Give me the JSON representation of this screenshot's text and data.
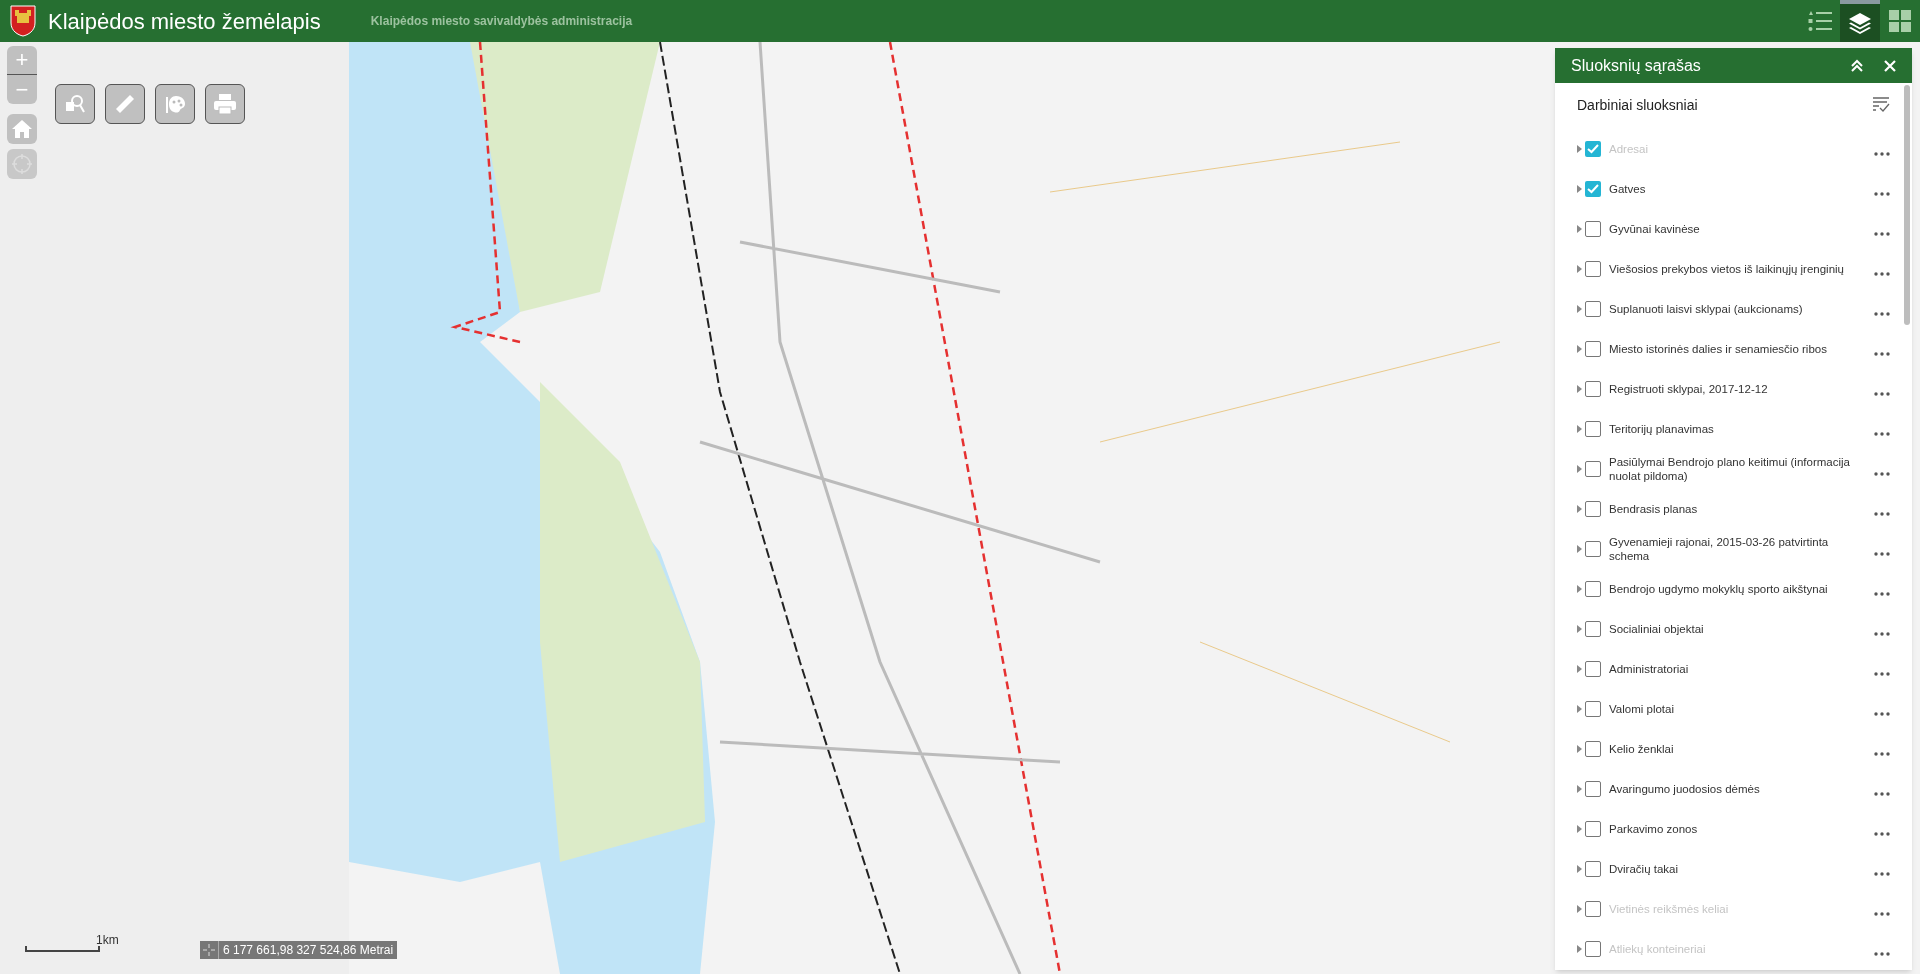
{
  "header": {
    "title": "Klaipėdos miesto žemėlapis",
    "subtitle": "Klaipėdos miesto savivaldybės administracija",
    "tools": [
      {
        "kind": "legend",
        "selected": false
      },
      {
        "kind": "layers",
        "selected": true
      },
      {
        "kind": "apps",
        "selected": false
      }
    ]
  },
  "map_tools": [
    {
      "kind": "search"
    },
    {
      "kind": "measure"
    },
    {
      "kind": "draw"
    },
    {
      "kind": "print"
    }
  ],
  "zoom": {
    "in": "+",
    "out": "−"
  },
  "scalebar": {
    "label": "1km"
  },
  "coordinates": {
    "text": "6 177 661,98 327 524,86 Metrai"
  },
  "panel": {
    "title": "Sluoksnių sąrašas",
    "section": "Darbiniai sluoksniai",
    "layers": [
      {
        "name": "Adresai",
        "checked": true,
        "dimmed": true
      },
      {
        "name": "Gatves",
        "checked": true,
        "dimmed": false
      },
      {
        "name": "Gyvūnai kavinėse",
        "checked": false,
        "dimmed": false
      },
      {
        "name": "Viešosios prekybos vietos iš laikinųjų įrenginių",
        "checked": false,
        "dimmed": false
      },
      {
        "name": "Suplanuoti laisvi sklypai (aukcionams)",
        "checked": false,
        "dimmed": false
      },
      {
        "name": "Miesto istorinės dalies ir senamiesčio ribos",
        "checked": false,
        "dimmed": false
      },
      {
        "name": "Registruoti sklypai, 2017-12-12",
        "checked": false,
        "dimmed": false
      },
      {
        "name": "Teritorijų planavimas",
        "checked": false,
        "dimmed": false
      },
      {
        "name": "Pasiūlymai Bendrojo plano keitimui (informacija nuolat pildoma)",
        "checked": false,
        "dimmed": false
      },
      {
        "name": "Bendrasis planas",
        "checked": false,
        "dimmed": false
      },
      {
        "name": "Gyvenamieji rajonai, 2015-03-26 patvirtinta schema",
        "checked": false,
        "dimmed": false
      },
      {
        "name": "Bendrojo ugdymo mokyklų sporto aikštynai",
        "checked": false,
        "dimmed": false
      },
      {
        "name": "Socialiniai objektai",
        "checked": false,
        "dimmed": false
      },
      {
        "name": "Administratoriai",
        "checked": false,
        "dimmed": false
      },
      {
        "name": "Valomi plotai",
        "checked": false,
        "dimmed": false
      },
      {
        "name": "Kelio ženklai",
        "checked": false,
        "dimmed": false
      },
      {
        "name": "Avaringumo juodosios dėmės",
        "checked": false,
        "dimmed": false
      },
      {
        "name": "Parkavimo zonos",
        "checked": false,
        "dimmed": false
      },
      {
        "name": "Dviračių takai",
        "checked": false,
        "dimmed": false
      },
      {
        "name": "Vietinės reikšmės keliai",
        "checked": false,
        "dimmed": true
      },
      {
        "name": "Atliekų konteineriai",
        "checked": false,
        "dimmed": true
      }
    ]
  }
}
